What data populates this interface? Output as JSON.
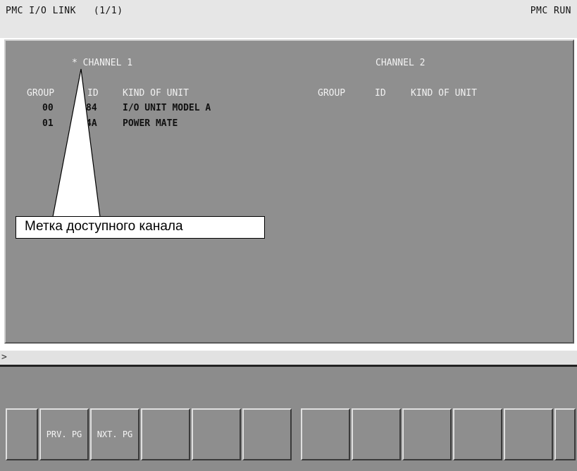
{
  "header": {
    "title": "PMC I/O LINK   (1/1)",
    "status": "PMC RUN"
  },
  "channel1": {
    "title": "* CHANNEL 1",
    "col_group": "GROUP",
    "col_id": "ID",
    "col_kind": "KIND OF UNIT",
    "rows": [
      {
        "group": "00",
        "id": "84",
        "kind": "I/O UNIT MODEL A"
      },
      {
        "group": "01",
        "id": "4A",
        "kind": "POWER MATE"
      }
    ]
  },
  "channel2": {
    "title": "CHANNEL 2",
    "col_group": "GROUP",
    "col_id": "ID",
    "col_kind": "KIND OF UNIT"
  },
  "command": {
    "prompt": ">"
  },
  "softkeys": [
    "",
    "PRV. PG",
    "NXT. PG",
    "",
    "",
    "",
    "",
    "",
    "",
    "",
    "",
    ""
  ],
  "callout": {
    "text": "Метка доступного канала"
  }
}
